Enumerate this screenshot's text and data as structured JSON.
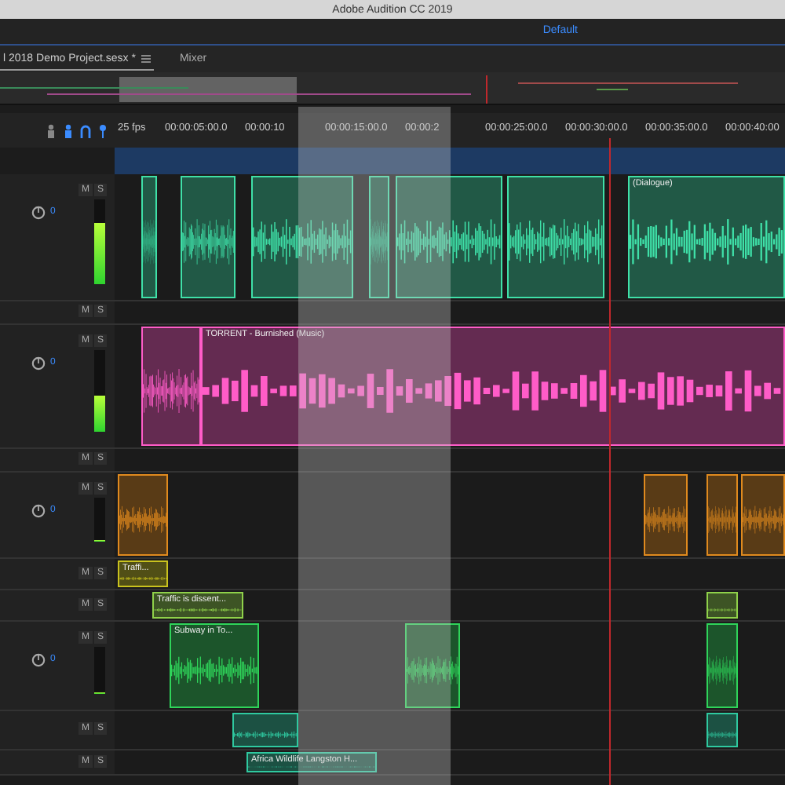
{
  "window": {
    "title": "Adobe Audition CC 2019"
  },
  "workspace": {
    "label": "Default"
  },
  "tabs": [
    {
      "label": "l 2018 Demo Project.sesx *",
      "selected": true
    },
    {
      "label": "Mixer",
      "selected": false
    }
  ],
  "ruler": {
    "fps": "25 fps",
    "ticks": [
      "00:00:05:00.0",
      "00:00:10",
      "00:00:15:00.0",
      "00:00:2",
      "00:00:25:00.0",
      "00:00:30:00.0",
      "00:00:35:00.0",
      "00:00:40:00"
    ]
  },
  "tracks": [
    {
      "kind": "audio",
      "mute": "M",
      "solo": "S",
      "volume": "0",
      "level": 0.72,
      "color": "#3fe0a8",
      "clips": [
        {
          "kind": "audio"
        },
        {
          "kind": "audio"
        },
        {
          "kind": "audio"
        },
        {
          "kind": "audio"
        },
        {
          "kind": "audio"
        },
        {
          "kind": "audio"
        },
        {
          "kind": "audio",
          "title": "(Dialogue)"
        }
      ]
    },
    {
      "kind": "bus",
      "mute": "M",
      "solo": "S"
    },
    {
      "kind": "audio",
      "mute": "M",
      "solo": "S",
      "volume": "0",
      "level": 0.45,
      "color": "#ff5cc8",
      "clips": [
        {
          "kind": "audio"
        },
        {
          "kind": "audio",
          "title": "TORRENT - Burnished (Music)"
        }
      ]
    },
    {
      "kind": "bus",
      "mute": "M",
      "solo": "S"
    },
    {
      "kind": "audio",
      "mute": "M",
      "solo": "S",
      "volume": "0",
      "level": 0.05,
      "color": "#e08a1e",
      "clips": [
        {
          "kind": "audio"
        },
        {
          "kind": "audio"
        },
        {
          "kind": "audio"
        },
        {
          "kind": "audio"
        }
      ]
    },
    {
      "kind": "compact",
      "mute": "M",
      "solo": "S",
      "color": "#c9c21e",
      "clips": [
        {
          "kind": "audio",
          "title": "Traffi..."
        }
      ]
    },
    {
      "kind": "compact",
      "mute": "M",
      "solo": "S",
      "color": "#8fd14a",
      "clips": [
        {
          "kind": "audio",
          "title": "Traffic is dissent..."
        },
        {
          "kind": "audio"
        }
      ]
    },
    {
      "kind": "audio",
      "mute": "M",
      "solo": "S",
      "volume": "0",
      "level": 0.05,
      "color": "#2fd45a",
      "clips": [
        {
          "kind": "audio",
          "title": "Subway in To..."
        },
        {
          "kind": "audio"
        },
        {
          "kind": "audio"
        }
      ]
    },
    {
      "kind": "compact",
      "mute": "M",
      "solo": "S",
      "color": "#2fc9a0",
      "clips": [
        {
          "kind": "audio"
        },
        {
          "kind": "audio"
        }
      ]
    },
    {
      "kind": "compact",
      "mute": "M",
      "solo": "S",
      "color": "#2fc9a0",
      "clips": [
        {
          "kind": "audio",
          "title": "Africa Wildlife Langston H..."
        }
      ]
    }
  ]
}
